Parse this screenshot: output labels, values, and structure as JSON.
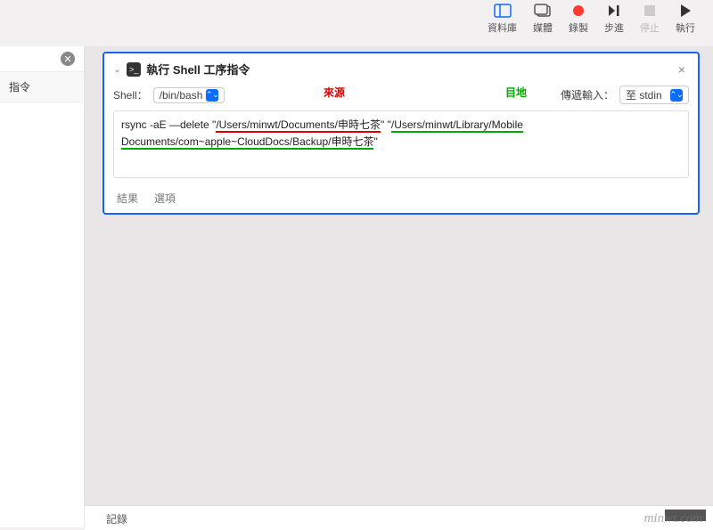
{
  "toolbar": {
    "items": [
      {
        "label": "資料庫",
        "icon": "db"
      },
      {
        "label": "媒體",
        "icon": "media"
      },
      {
        "label": "錄製",
        "icon": "rec"
      },
      {
        "label": "步進",
        "icon": "step"
      },
      {
        "label": "停止",
        "icon": "stop",
        "disabled": true
      },
      {
        "label": "執行",
        "icon": "play"
      }
    ]
  },
  "sidebar": {
    "tab_label": "指令"
  },
  "panel": {
    "title": "執行 Shell 工序指令",
    "shell_label": "Shell：",
    "shell_value": "/bin/bash",
    "pass_label": "傳遞輸入：",
    "pass_value": "至 stdin",
    "ann_source": "來源",
    "ann_dest": "目地",
    "code": {
      "prefix": "rsync -aE —delete \"",
      "src_path": "/Users/minwt/Documents/申時七茶",
      "mid": "\" \"",
      "dst_path1": "/Users/minwt/Library/Mobile ",
      "dst_path2": "Documents/com~apple~CloudDocs/Backup/申時七茶",
      "suffix": "\""
    },
    "tabs": [
      "結果",
      "選項"
    ]
  },
  "footer": {
    "log": "記錄"
  },
  "watermark": "minwt.com"
}
